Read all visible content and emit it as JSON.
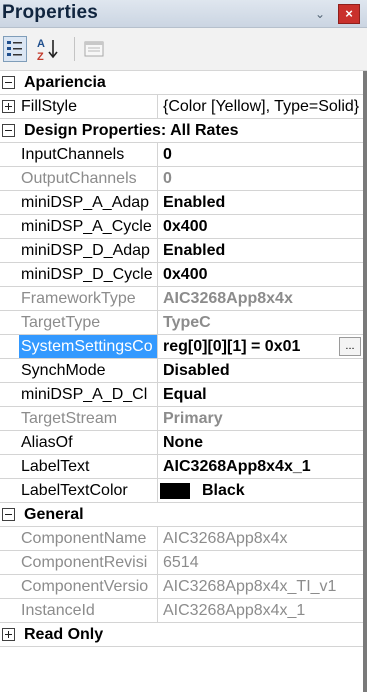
{
  "panel": {
    "title": "Properties",
    "pin_glyph": "⌄",
    "close_glyph": "×"
  },
  "toolbar": {
    "categorized_icon": "categorized-icon",
    "alphabetical_icon": "sort-alpha-icon",
    "alphabetical_label": "A↓Z",
    "property_pages_icon": "property-pages-icon"
  },
  "grid": {
    "categories": {
      "apariencia": "Apariencia",
      "design": "Design Properties: All Rates",
      "general": "General",
      "read_only": "Read Only"
    },
    "fillstyle": {
      "name": "FillStyle",
      "value": "{Color [Yellow], Type=Solid}"
    },
    "design_rows": [
      {
        "name": "InputChannels",
        "value": "0"
      },
      {
        "name": "OutputChannels",
        "value": "0"
      },
      {
        "name": "miniDSP_A_Adap",
        "value": "Enabled"
      },
      {
        "name": "miniDSP_A_Cycle",
        "value": "0x400"
      },
      {
        "name": "miniDSP_D_Adap",
        "value": "Enabled"
      },
      {
        "name": "miniDSP_D_Cycle",
        "value": "0x400"
      },
      {
        "name": "FrameworkType",
        "value": "AIC3268App8x4x"
      },
      {
        "name": "TargetType",
        "value": "TypeC"
      },
      {
        "name": "SystemSettingsCo",
        "value": "reg[0][0][1] = 0x01",
        "button": "..."
      },
      {
        "name": "SynchMode",
        "value": "Disabled"
      },
      {
        "name": "miniDSP_A_D_Cl",
        "value": "Equal"
      },
      {
        "name": "TargetStream",
        "value": "Primary"
      },
      {
        "name": "AliasOf",
        "value": "None"
      },
      {
        "name": "LabelText",
        "value": "AIC3268App8x4x_1"
      },
      {
        "name": "LabelTextColor",
        "value": "Black",
        "swatch_color": "#000000"
      }
    ],
    "general_rows": [
      {
        "name": "ComponentName",
        "value": "AIC3268App8x4x"
      },
      {
        "name": "ComponentRevisi",
        "value": "6514"
      },
      {
        "name": "ComponentVersio",
        "value": "AIC3268App8x4x_TI_v1"
      },
      {
        "name": "InstanceId",
        "value": "AIC3268App8x4x_1"
      }
    ]
  },
  "colors": {
    "selection": "#3399ff",
    "disabled_text": "#8c8c8c",
    "close_button": "#c9302c"
  }
}
